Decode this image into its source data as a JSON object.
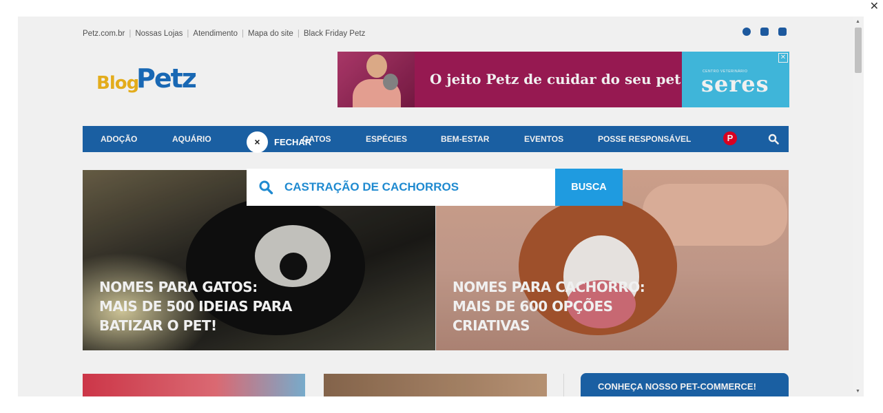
{
  "window": {
    "close_glyph": "✕"
  },
  "top_links": [
    {
      "label": "Petz.com.br"
    },
    {
      "label": "Nossas Lojas"
    },
    {
      "label": "Atendimento"
    },
    {
      "label": "Mapa do site"
    },
    {
      "label": "Black Friday Petz"
    }
  ],
  "social": [
    "facebook-icon",
    "youtube-icon",
    "instagram-icon"
  ],
  "logo": {
    "part1": "Blog",
    "part2": "Petz"
  },
  "banner": {
    "headline": "O jeito Petz  de cuidar do seu pet.",
    "brand_small": "CENTRO VETERINÁRIO",
    "brand": "seres",
    "close": "✕"
  },
  "nav": {
    "items": [
      "ADOÇÃO",
      "AQUÁRIO",
      "GATOS",
      "ESPÉCIES",
      "BEM-ESTAR",
      "EVENTOS",
      "POSSE RESPONSÁVEL"
    ],
    "pinterest": "P"
  },
  "hero": [
    {
      "headline": "NOMES PARA GATOS:\nMAIS DE 500 IDEIAS PARA\nBATIZAR O PET!"
    },
    {
      "headline": "NOMES PARA CACHORRO:\nMAIS DE 600 OPÇÕES\nCRIATIVAS"
    }
  ],
  "sidebar": {
    "button_label": "CONHEÇA NOSSO PET-COMMERCE!"
  },
  "search_overlay": {
    "close_glyph": "×",
    "close_label": "FECHAR",
    "query": "CASTRAÇÃO DE CACHORROS",
    "button_label": "BUSCA"
  },
  "colors": {
    "nav_blue": "#1c65ad",
    "search_blue": "#1f9be0",
    "query_text": "#1f8ad0",
    "banner_magenta": "#a01b57",
    "seres_cyan": "#43c1e7"
  },
  "scrollbar": {
    "up": "▲",
    "down": "▼"
  }
}
